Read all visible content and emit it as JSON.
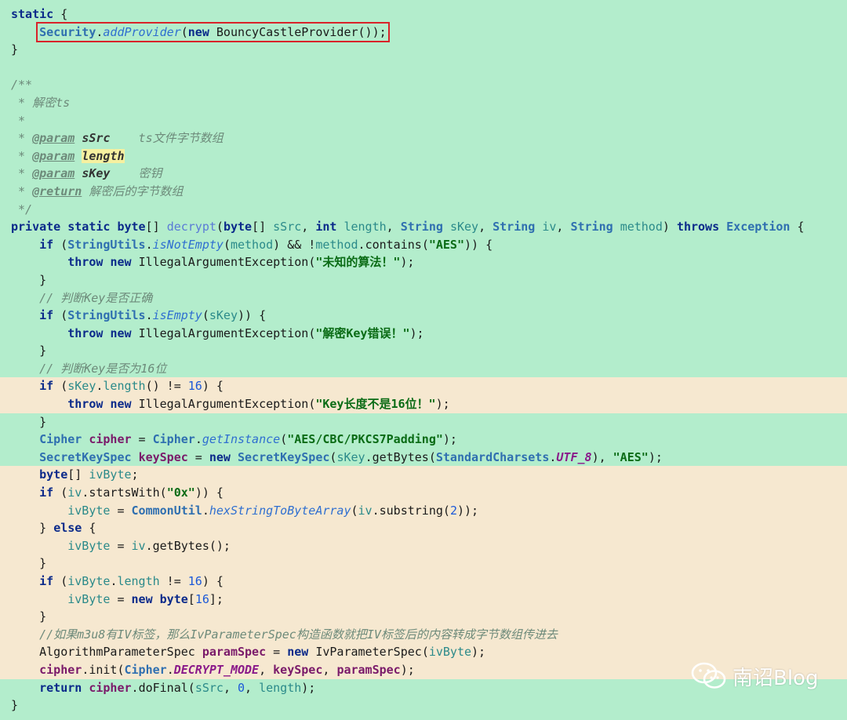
{
  "lines": [
    {
      "t": "static {",
      "hl": false
    },
    {
      "t": "    Security.addProvider(new BouncyCastleProvider());",
      "hl": false
    },
    {
      "t": "}",
      "hl": false
    },
    {
      "t": "",
      "hl": false
    },
    {
      "t": "/**",
      "hl": false
    },
    {
      "t": " * 解密ts",
      "hl": false
    },
    {
      "t": " *",
      "hl": false
    },
    {
      "t": " * @param sSrc    ts文件字节数组",
      "hl": false
    },
    {
      "t": " * @param length",
      "hl": false
    },
    {
      "t": " * @param sKey    密钥",
      "hl": false
    },
    {
      "t": " * @return 解密后的字节数组",
      "hl": false
    },
    {
      "t": " */",
      "hl": false
    },
    {
      "t": "private static byte[] decrypt(byte[] sSrc, int length, String sKey, String iv, String method) throws Exception {",
      "hl": false
    },
    {
      "t": "    if (StringUtils.isNotEmpty(method) && !method.contains(\"AES\")) {",
      "hl": false
    },
    {
      "t": "        throw new IllegalArgumentException(\"未知的算法！\");",
      "hl": false
    },
    {
      "t": "    }",
      "hl": false
    },
    {
      "t": "    // 判断Key是否正确",
      "hl": false
    },
    {
      "t": "    if (StringUtils.isEmpty(sKey)) {",
      "hl": false
    },
    {
      "t": "        throw new IllegalArgumentException(\"解密Key错误！\");",
      "hl": false
    },
    {
      "t": "    }",
      "hl": false
    },
    {
      "t": "    // 判断Key是否为16位",
      "hl": false
    },
    {
      "t": "    if (sKey.length() != 16) {",
      "hl": true
    },
    {
      "t": "        throw new IllegalArgumentException(\"Key长度不是16位！\");",
      "hl": true
    },
    {
      "t": "    }",
      "hl": false
    },
    {
      "t": "    Cipher cipher = Cipher.getInstance(\"AES/CBC/PKCS7Padding\");",
      "hl": false
    },
    {
      "t": "    SecretKeySpec keySpec = new SecretKeySpec(sKey.getBytes(StandardCharsets.UTF_8), \"AES\");",
      "hl": false
    },
    {
      "t": "    byte[] ivByte;",
      "hl": true
    },
    {
      "t": "    if (iv.startsWith(\"0x\")) {",
      "hl": true
    },
    {
      "t": "        ivByte = CommonUtil.hexStringToByteArray(iv.substring(2));",
      "hl": true
    },
    {
      "t": "    } else {",
      "hl": true
    },
    {
      "t": "        ivByte = iv.getBytes();",
      "hl": true
    },
    {
      "t": "    }",
      "hl": true
    },
    {
      "t": "    if (ivByte.length != 16) {",
      "hl": true
    },
    {
      "t": "        ivByte = new byte[16];",
      "hl": true
    },
    {
      "t": "    }",
      "hl": true
    },
    {
      "t": "    //如果m3u8有IV标签，那么IvParameterSpec构造函数就把IV标签后的内容转成字节数组传进去",
      "hl": true
    },
    {
      "t": "    AlgorithmParameterSpec paramSpec = new IvParameterSpec(ivByte);",
      "hl": true
    },
    {
      "t": "    cipher.init(Cipher.DECRYPT_MODE, keySpec, paramSpec);",
      "hl": true
    },
    {
      "t": "    return cipher.doFinal(sSrc, 0, length);",
      "hl": false
    },
    {
      "t": "}",
      "hl": false
    }
  ],
  "watermark": {
    "text": "南诏Blog",
    "icon": "wechat-icon"
  },
  "colors": {
    "background": "#b3edcc",
    "highlight_row": "#f6e8d0",
    "box_outline": "#d9232a"
  }
}
